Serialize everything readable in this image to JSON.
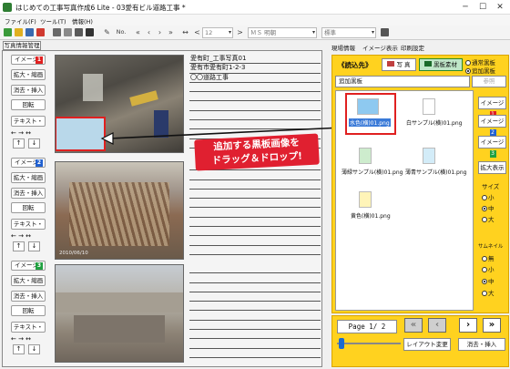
{
  "window": {
    "title": "はじめての工事写真作成6 Lite - 03愛有ビル道路工事 *"
  },
  "menu": [
    "ファイル(F)",
    "ツール(T)",
    "情報(H)"
  ],
  "toolbar": {
    "font_size": "12",
    "font_name": "ＭＳ 明朝",
    "style": "標準",
    "no_label": "No."
  },
  "left": {
    "tab": "写真情報管理",
    "image_blocks": [
      {
        "label": "イメージ",
        "badge": "1",
        "badge_color": "#e02020"
      },
      {
        "label": "イメージ",
        "badge": "2",
        "badge_color": "#2060d0"
      },
      {
        "label": "イメージ",
        "badge": "3",
        "badge_color": "#20a040"
      }
    ],
    "btn_enlarge": "拡大・縮画",
    "btn_delete": "消去・挿入",
    "btn_rotate": "回転",
    "btn_text": "テキスト・",
    "arrows_lr": "← → ↔",
    "up": "↑",
    "down": "↓",
    "photo_dates": [
      "",
      "2010/06/10",
      ""
    ],
    "photo_info": [
      "愛有町_工事写真01",
      "愛有市愛有町1-2-3",
      "〇〇道路工事"
    ]
  },
  "annotation": {
    "line1": "追加する黒板画像を",
    "line2": "ドラッグ＆ドロップ!"
  },
  "right": {
    "tabs": [
      "現場情報",
      "イメージ表示",
      "印刷設定"
    ],
    "read_label": "《読込先》",
    "btn_photo": "写 真",
    "btn_board": "黒板素材",
    "radio_normal": "通常黒板",
    "radio_add": "追加黒板",
    "folder": "追加黒板",
    "btn_folder": "参照",
    "thumbnails": [
      "水色(横)01.png",
      "白サンプル(横)01.png",
      "薄緑サンプル(横)01.png",
      "薄青サンプル(横)01.png",
      "黄色(横)01.png"
    ],
    "thumb_colors": [
      "#8ec9f0",
      "#ffffff",
      "#cdeccd",
      "#d3ecf8",
      "#fff4b8"
    ],
    "image_btns": [
      "イメージ",
      "イメージ",
      "イメージ"
    ],
    "btn_zoom": "拡大表示",
    "size_label": "サイズ",
    "size_opts": [
      "小",
      "中",
      "大"
    ],
    "thumb_label": "サムネイル",
    "thumb_opts": [
      "無",
      "小",
      "中",
      "大"
    ],
    "page": "Page 1/ 2",
    "btn_layout": "レイアウト変更",
    "btn_insert": "消去・挿入"
  }
}
